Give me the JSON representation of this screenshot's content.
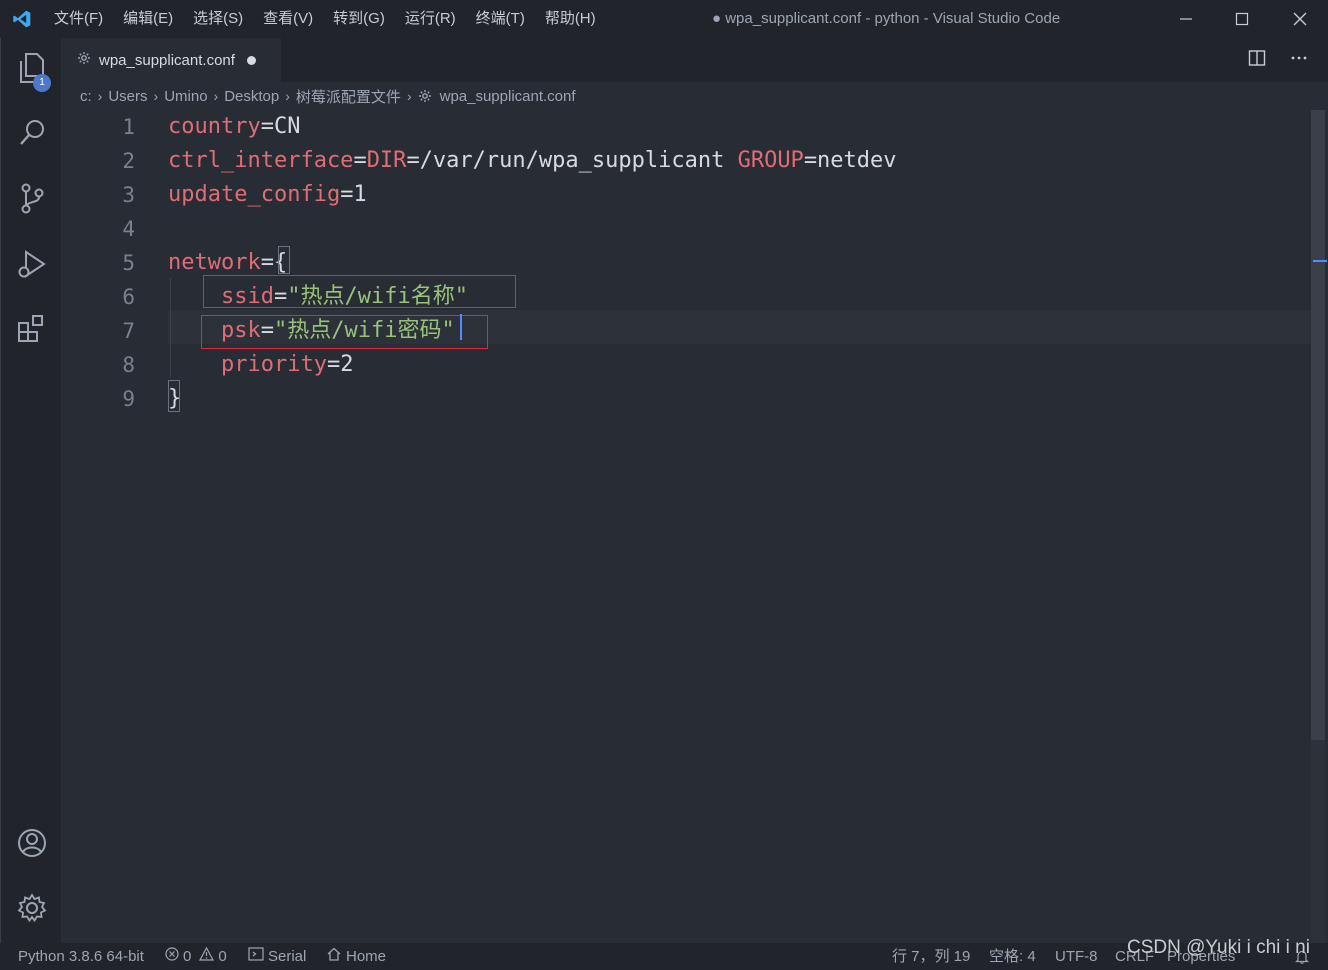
{
  "titlebar": {
    "menu": [
      "文件(F)",
      "编辑(E)",
      "选择(S)",
      "查看(V)",
      "转到(G)",
      "运行(R)",
      "终端(T)",
      "帮助(H)"
    ],
    "window_title": "● wpa_supplicant.conf - python - Visual Studio Code"
  },
  "activitybar": {
    "icons": [
      "explorer-icon",
      "search-icon",
      "source-control-icon",
      "run-debug-icon",
      "extensions-icon",
      "account-icon",
      "manage-gear-icon"
    ],
    "explorer_badge": "1"
  },
  "tab": {
    "label": "wpa_supplicant.conf",
    "dirty": true
  },
  "breadcrumb": {
    "items": [
      "c:",
      "Users",
      "Umino",
      "Desktop",
      "树莓派配置文件",
      "wpa_supplicant.conf"
    ]
  },
  "editor": {
    "line_numbers": [
      "1",
      "2",
      "3",
      "4",
      "5",
      "6",
      "7",
      "8",
      "9"
    ],
    "lines": [
      [
        {
          "t": "country",
          "c": "k"
        },
        {
          "t": "=CN",
          "c": "op"
        }
      ],
      [
        {
          "t": "ctrl_interface",
          "c": "k"
        },
        {
          "t": "=",
          "c": "op"
        },
        {
          "t": "DIR",
          "c": "k"
        },
        {
          "t": "=/var/run/wpa_supplicant ",
          "c": "op"
        },
        {
          "t": "GROUP",
          "c": "k"
        },
        {
          "t": "=netdev",
          "c": "op"
        }
      ],
      [
        {
          "t": "update_config",
          "c": "k"
        },
        {
          "t": "=1",
          "c": "op"
        }
      ],
      [],
      [
        {
          "t": "network",
          "c": "k"
        },
        {
          "t": "={",
          "c": "op"
        }
      ],
      [
        {
          "t": "    ",
          "c": "op"
        },
        {
          "t": "ssid",
          "c": "k"
        },
        {
          "t": "=",
          "c": "op"
        },
        {
          "t": "\"热点/wifi名称\"",
          "c": "str"
        }
      ],
      [
        {
          "t": "    ",
          "c": "op"
        },
        {
          "t": "psk",
          "c": "k"
        },
        {
          "t": "=",
          "c": "op"
        },
        {
          "t": "\"热点/wifi密码\"",
          "c": "str"
        }
      ],
      [
        {
          "t": "    ",
          "c": "op"
        },
        {
          "t": "priority",
          "c": "k"
        },
        {
          "t": "=2",
          "c": "op"
        }
      ],
      [
        {
          "t": "}",
          "c": "op"
        }
      ]
    ]
  },
  "statusbar": {
    "python": "Python 3.8.6 64-bit",
    "errors": "0",
    "warnings": "0",
    "serial": "Serial",
    "home": "Home",
    "position": "行 7，列 19",
    "spaces": "空格: 4",
    "encoding": "UTF-8",
    "eol": "CRLF",
    "properties": "Properties"
  },
  "watermark": "CSDN @Yuki i chi i ni",
  "colors": {
    "keyword": "#e06c75",
    "string": "#98c379",
    "background": "#282c34",
    "annotation_box": "#e0293a"
  }
}
